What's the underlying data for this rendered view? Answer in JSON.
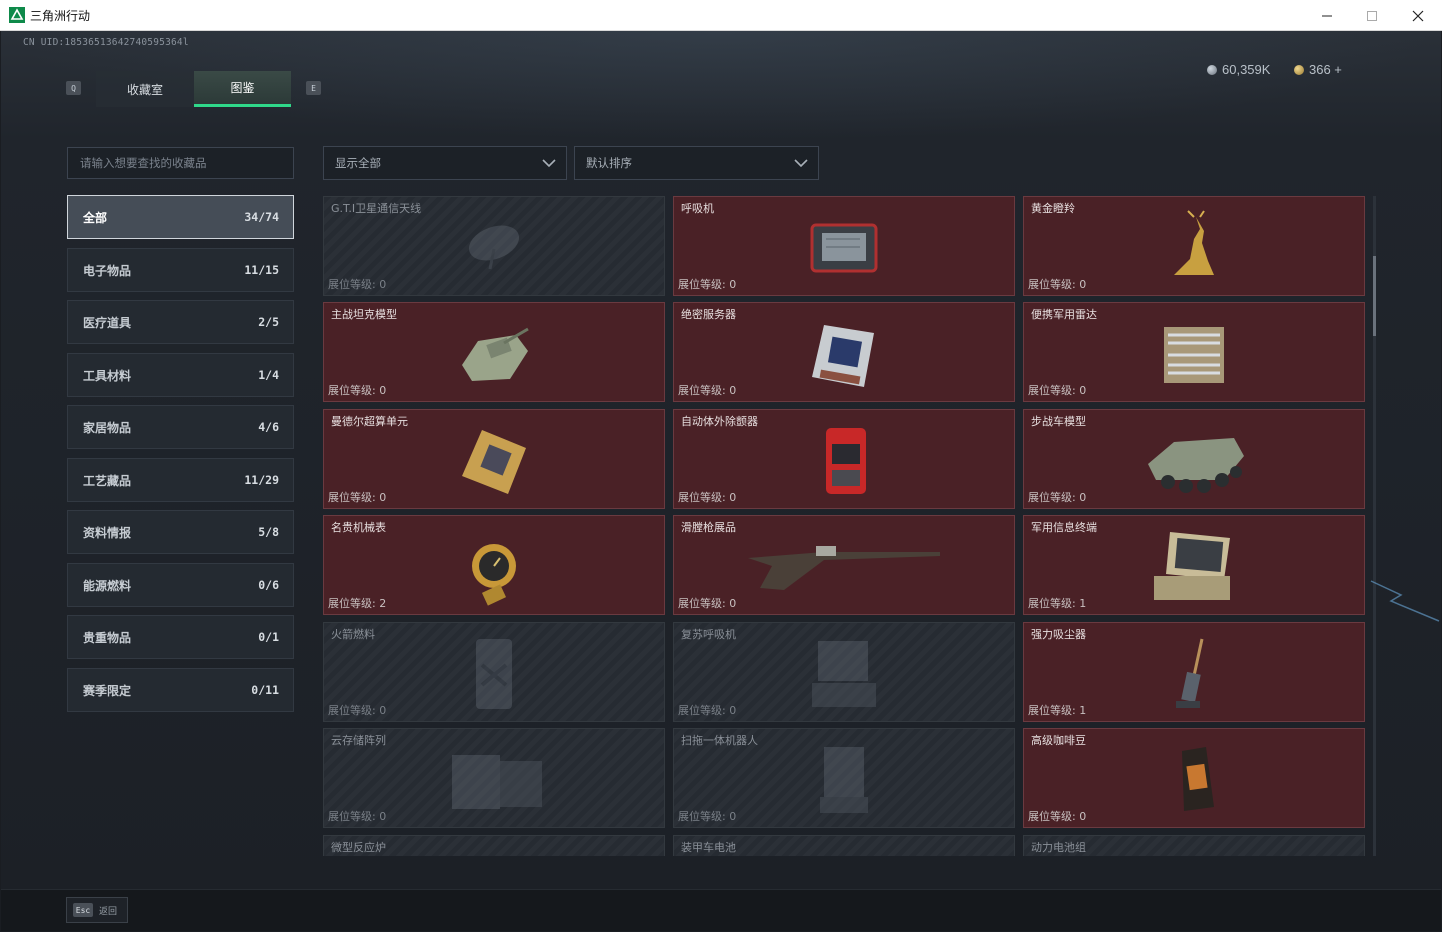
{
  "window": {
    "title": "三角洲行动",
    "minimize": "—",
    "maximize": "☐",
    "close": "✕"
  },
  "header": {
    "uid": "CN UID:18536513642740595364l",
    "currency": [
      {
        "value": "60,359K",
        "color": "#9aa4ae",
        "icon": "silver-coin-icon"
      },
      {
        "value": "366 +",
        "color": "#d4b060",
        "icon": "gold-coin-icon"
      }
    ],
    "key_left": "Q",
    "key_right": "E",
    "tabs": [
      {
        "label": "收藏室",
        "active": false
      },
      {
        "label": "图鉴",
        "active": true
      }
    ]
  },
  "search": {
    "placeholder": "请输入想要查找的收藏品"
  },
  "filters": {
    "show": "显示全部",
    "sort": "默认排序"
  },
  "categories": [
    {
      "label": "全部",
      "count": "34/74",
      "selected": true
    },
    {
      "label": "电子物品",
      "count": "11/15"
    },
    {
      "label": "医疗道具",
      "count": "2/5"
    },
    {
      "label": "工具材料",
      "count": "1/4"
    },
    {
      "label": "家居物品",
      "count": "4/6"
    },
    {
      "label": "工艺藏品",
      "count": "11/29"
    },
    {
      "label": "资料情报",
      "count": "5/8"
    },
    {
      "label": "能源燃料",
      "count": "0/6"
    },
    {
      "label": "贵重物品",
      "count": "0/1"
    },
    {
      "label": "赛季限定",
      "count": "0/11"
    }
  ],
  "level_label": "展位等级:",
  "items": [
    {
      "name": "G.T.I卫星通信天线",
      "level": "0",
      "owned": false,
      "icon": "satellite-dish-icon"
    },
    {
      "name": "呼吸机",
      "level": "0",
      "owned": true,
      "icon": "ventilator-icon"
    },
    {
      "name": "黄金瞪羚",
      "level": "0",
      "owned": true,
      "icon": "golden-gazelle-icon"
    },
    {
      "name": "主战坦克模型",
      "level": "0",
      "owned": true,
      "icon": "tank-model-icon"
    },
    {
      "name": "绝密服务器",
      "level": "0",
      "owned": true,
      "icon": "server-icon"
    },
    {
      "name": "便携军用雷达",
      "level": "0",
      "owned": true,
      "icon": "radar-icon"
    },
    {
      "name": "曼德尔超算单元",
      "level": "0",
      "owned": true,
      "icon": "compute-unit-icon"
    },
    {
      "name": "自动体外除颤器",
      "level": "0",
      "owned": true,
      "icon": "defibrillator-icon"
    },
    {
      "name": "步战车模型",
      "level": "0",
      "owned": true,
      "icon": "ifv-model-icon"
    },
    {
      "name": "名贵机械表",
      "level": "2",
      "owned": true,
      "icon": "watch-icon"
    },
    {
      "name": "滑膛枪展品",
      "level": "0",
      "owned": true,
      "icon": "musket-icon"
    },
    {
      "name": "军用信息终端",
      "level": "1",
      "owned": true,
      "icon": "terminal-icon"
    },
    {
      "name": "火箭燃料",
      "level": "0",
      "owned": false,
      "icon": "rocket-fuel-icon"
    },
    {
      "name": "复苏呼吸机",
      "level": "0",
      "owned": false,
      "icon": "resuscitator-icon"
    },
    {
      "name": "强力吸尘器",
      "level": "1",
      "owned": true,
      "icon": "vacuum-icon"
    },
    {
      "name": "云存储阵列",
      "level": "0",
      "owned": false,
      "icon": "storage-array-icon"
    },
    {
      "name": "扫拖一体机器人",
      "level": "0",
      "owned": false,
      "icon": "robot-vacuum-icon"
    },
    {
      "name": "高级咖啡豆",
      "level": "0",
      "owned": true,
      "icon": "coffee-bag-icon"
    },
    {
      "name": "微型反应炉",
      "level": "",
      "owned": false,
      "icon": "reactor-icon"
    },
    {
      "name": "装甲车电池",
      "level": "",
      "owned": false,
      "icon": "battery-icon"
    },
    {
      "name": "动力电池组",
      "level": "",
      "owned": false,
      "icon": "battery-pack-icon"
    }
  ],
  "footer": {
    "key": "Esc",
    "label": "返回"
  },
  "colors": {
    "accent": "#2fd98a",
    "owned_card": "#4a2126",
    "locked_card": "#262b32"
  }
}
